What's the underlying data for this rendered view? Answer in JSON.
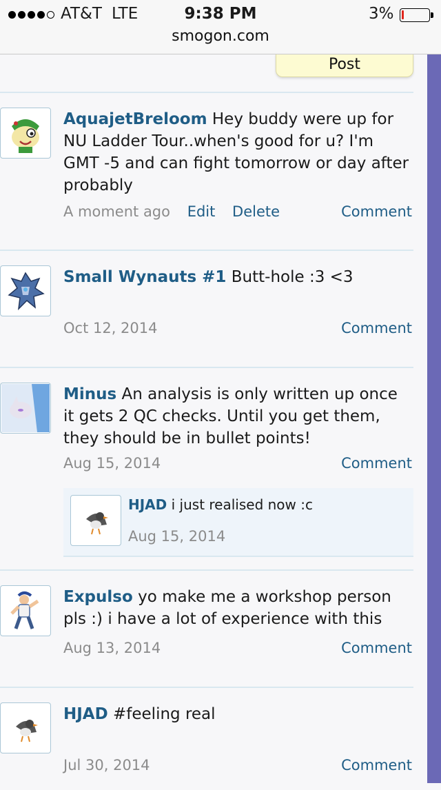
{
  "status_bar": {
    "carrier": "AT&T",
    "network": "LTE",
    "time": "9:38 PM",
    "battery": "3%"
  },
  "browser": {
    "url": "smogon.com"
  },
  "post_button": "Post",
  "entries": [
    {
      "user": "AquajetBreloom",
      "text": "Hey buddy were up for NU Ladder Tour..when's good for u? I'm GMT -5 and can fight tomorrow or day after probably",
      "date": "A moment ago",
      "edit": "Edit",
      "delete": "Delete",
      "comment": "Comment"
    },
    {
      "user": "Small Wynauts #1",
      "text": "Butt-hole :3 <3",
      "date": "Oct 12, 2014",
      "comment": "Comment"
    },
    {
      "user": "Minus",
      "text": "An analysis is only written up once it gets 2 QC checks. Until you get them, they should be in bullet points!",
      "date": "Aug 15, 2014",
      "comment": "Comment",
      "reply": {
        "user": "HJAD",
        "text": "i just realised now :c",
        "date": "Aug 15, 2014"
      }
    },
    {
      "user": "Expulso",
      "text": "yo make me a workshop person pls :) i have a lot of experience with this",
      "date": "Aug 13, 2014",
      "comment": "Comment"
    },
    {
      "user": "HJAD",
      "text": "#feeling real",
      "date": "Jul 30, 2014",
      "comment": "Comment"
    }
  ]
}
